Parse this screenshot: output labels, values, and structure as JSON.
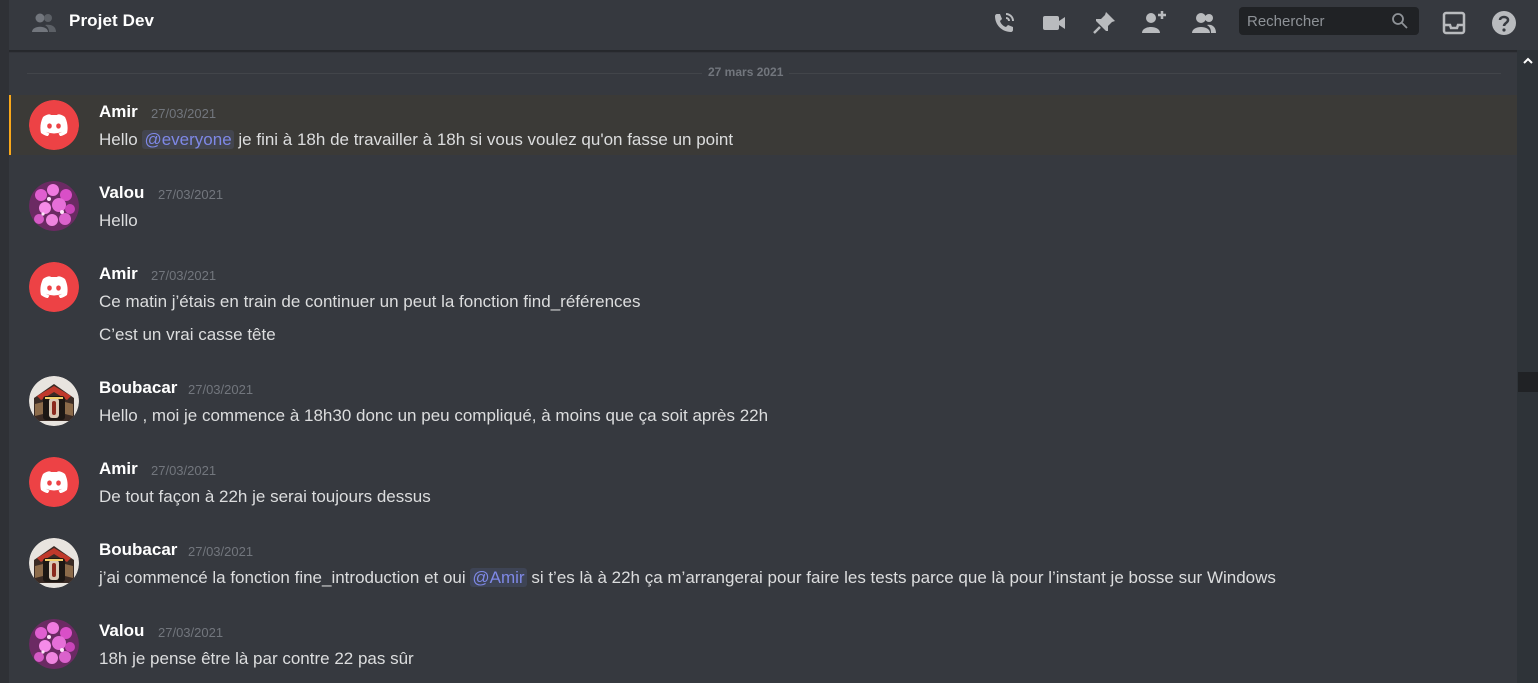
{
  "header": {
    "channel_title": "Projet Dev",
    "search_placeholder": "Rechercher",
    "icons": [
      "group-icon",
      "phone-call-icon",
      "video-call-icon",
      "pin-icon",
      "add-friend-icon",
      "member-list-icon",
      "search-icon",
      "inbox-icon",
      "help-icon"
    ]
  },
  "divider": {
    "date_label": "27 mars 2021"
  },
  "messages": [
    {
      "author": "Amir",
      "timestamp": "27/03/2021",
      "avatar": "discord-red-logo",
      "lines": [
        {
          "before": "Hello ",
          "mention": "@everyone",
          "after": " je fini à 18h de travailler à 18h si vous voulez qu'on fasse un point"
        }
      ],
      "highlighted": true
    },
    {
      "author": "Valou",
      "timestamp": "27/03/2021",
      "avatar": "pink-flowers",
      "lines": [
        {
          "text": "Hello"
        }
      ]
    },
    {
      "author": "Amir",
      "timestamp": "27/03/2021",
      "avatar": "discord-red-logo",
      "lines": [
        {
          "text": "Ce matin j’étais en train de continuer un peut la fonction find_références"
        },
        {
          "text": "C’est un vrai casse tête"
        }
      ]
    },
    {
      "author": "Boubacar",
      "timestamp": "27/03/2021",
      "avatar": "robot-portrait",
      "lines": [
        {
          "text": "Hello , moi je commence à 18h30 donc un peu compliqué, à moins que ça soit après 22h"
        }
      ]
    },
    {
      "author": "Amir",
      "timestamp": "27/03/2021",
      "avatar": "discord-red-logo",
      "lines": [
        {
          "text": "De tout façon à 22h je serai toujours dessus"
        }
      ]
    },
    {
      "author": "Boubacar",
      "timestamp": "27/03/2021",
      "avatar": "robot-portrait",
      "lines": [
        {
          "before": "j’ai commencé la fonction fine_introduction et oui ",
          "mention": "@Amir",
          "after": " si t’es là à 22h ça m’arrangerai pour faire les tests parce que là pour l’instant je bosse sur Windows"
        }
      ]
    },
    {
      "author": "Valou",
      "timestamp": "27/03/2021",
      "avatar": "pink-flowers",
      "lines": [
        {
          "text": "18h je pense être là par contre 22 pas sûr"
        }
      ]
    }
  ],
  "colors": {
    "background": "#36393f",
    "header_text": "#ffffff",
    "message_text": "#dcddde",
    "timestamp": "#72767d",
    "mention": "#7e88e6",
    "highlight_bar": "#faa81a",
    "discord_red": "#ed4245"
  }
}
